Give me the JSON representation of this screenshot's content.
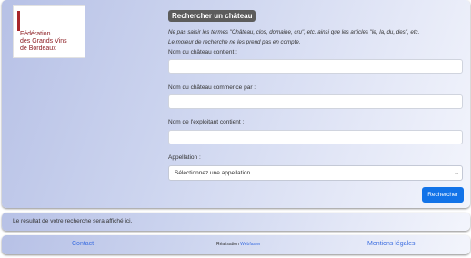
{
  "logo": {
    "lines": [
      "Fédération",
      "des Grands Vins",
      "de Bordeaux"
    ],
    "accent_color": "#a8262b"
  },
  "search": {
    "title": "Rechercher un château",
    "note_line1": "Ne pas saisir les termes \"Château, clos, domaine, cru\", etc. ainsi que les articles \"le, la, du, des\", etc.",
    "note_line2": "Le moteur de recherche ne les prend pas en compte.",
    "fields": [
      {
        "label": "Nom du château contient :",
        "value": ""
      },
      {
        "label": "Nom du château commence par :",
        "value": ""
      },
      {
        "label": "Nom de l'exploitant contient :",
        "value": ""
      }
    ],
    "appellation_label": "Appellation :",
    "appellation_selected": "Sélectionnez une appellation",
    "submit_label": "Rechercher",
    "submit_color": "#1273e8"
  },
  "result": {
    "text": "Le résultat de votre recherche sera affiché ici."
  },
  "footer": {
    "contact": "Contact",
    "credit_prefix": "Réalisation",
    "credit_company": "Webfaster",
    "legal": "Mentions légales"
  }
}
